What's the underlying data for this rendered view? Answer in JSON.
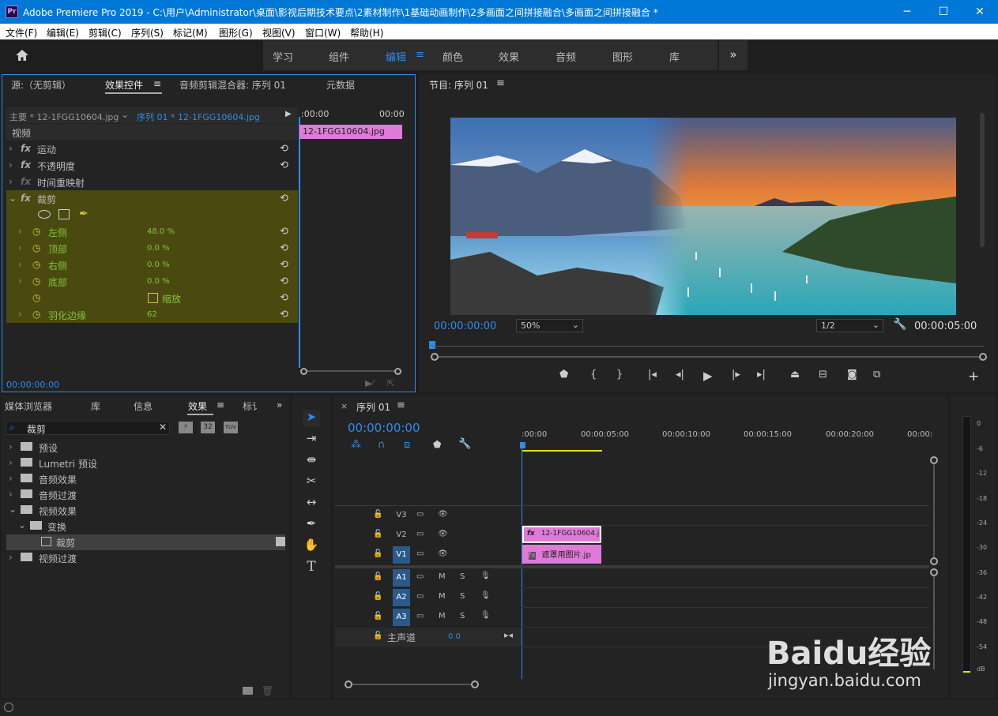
{
  "window": {
    "app_icon": "Pr",
    "title": "Adobe Premiere Pro 2019 - C:\\用户\\Administrator\\桌面\\影视后期技术要点\\2素材制作\\1基础动画制作\\2多画面之间拼接融合\\多画面之间拼接融合 *",
    "minimize": "─",
    "maximize": "☐",
    "close": "✕"
  },
  "menu": [
    "文件(F)",
    "编辑(E)",
    "剪辑(C)",
    "序列(S)",
    "标记(M)",
    "图形(G)",
    "视图(V)",
    "窗口(W)",
    "帮助(H)"
  ],
  "workspaces": [
    "学习",
    "组件",
    "编辑",
    "颜色",
    "效果",
    "音频",
    "图形",
    "库"
  ],
  "workspace_more": "»",
  "source_panel": {
    "tabs": [
      "源:（无剪辑）",
      "效果控件",
      "音频剪辑混合器: 序列 01",
      "元数据"
    ],
    "master": "主要 * 12-1FGG10604.jpg",
    "sequence": "序列 01 * 12-1FGG10604.jpg",
    "time_start": ":00:00",
    "time_end": "00:00",
    "clip_label": "12-1FGG10604.jpg",
    "section": "视频",
    "effects": [
      {
        "name": "运动"
      },
      {
        "name": "不透明度"
      },
      {
        "name": "时间重映射"
      },
      {
        "name": "裁剪"
      }
    ],
    "crop_params": [
      {
        "name": "左侧",
        "value": "48.0 %"
      },
      {
        "name": "顶部",
        "value": "0.0 %"
      },
      {
        "name": "右侧",
        "value": "0.0 %"
      },
      {
        "name": "底部",
        "value": "0.0 %"
      },
      {
        "name": "",
        "value": "缩放"
      },
      {
        "name": "羽化边缘",
        "value": "62"
      }
    ],
    "timecode": "00:00:00:00"
  },
  "program": {
    "title": "节目: 序列 01",
    "timecode": "00:00:00:00",
    "zoom": "50%",
    "resolution": "1/2",
    "duration": "00:00:05:00"
  },
  "effects_browser": {
    "tabs": [
      "媒体浏览器",
      "库",
      "信息",
      "效果",
      "标讠"
    ],
    "search": "裁剪",
    "tree": [
      {
        "label": "预设",
        "level": 0
      },
      {
        "label": "Lumetri 预设",
        "level": 0
      },
      {
        "label": "音频效果",
        "level": 0
      },
      {
        "label": "音频过渡",
        "level": 0
      },
      {
        "label": "视频效果",
        "level": 0
      },
      {
        "label": "变换",
        "level": 1
      },
      {
        "label": "裁剪",
        "level": 2
      },
      {
        "label": "视频过渡",
        "level": 0
      }
    ]
  },
  "timeline": {
    "tab": "序列 01",
    "timecode": "00:00:00:00",
    "ruler": [
      ":00:00",
      "00:00:05:00",
      "00:00:10:00",
      "00:00:15:00",
      "00:00:20:00",
      "00:00:"
    ],
    "video_tracks": [
      "V3",
      "V2",
      "V1"
    ],
    "audio_tracks": [
      "A1",
      "A2",
      "A3"
    ],
    "master": "主声道",
    "master_value": "0.0",
    "clip_v2": "12-1FGG10604.j",
    "clip_v1": "遮罩用图片.jp",
    "m": "M",
    "s": "S"
  },
  "meter": [
    "0",
    "-6",
    "-12",
    "-18",
    "-24",
    "-30",
    "-36",
    "-42",
    "-48",
    "-54",
    "dB"
  ],
  "watermark": {
    "brand": "Baidu经验",
    "url": "jingyan.baidu.com"
  }
}
